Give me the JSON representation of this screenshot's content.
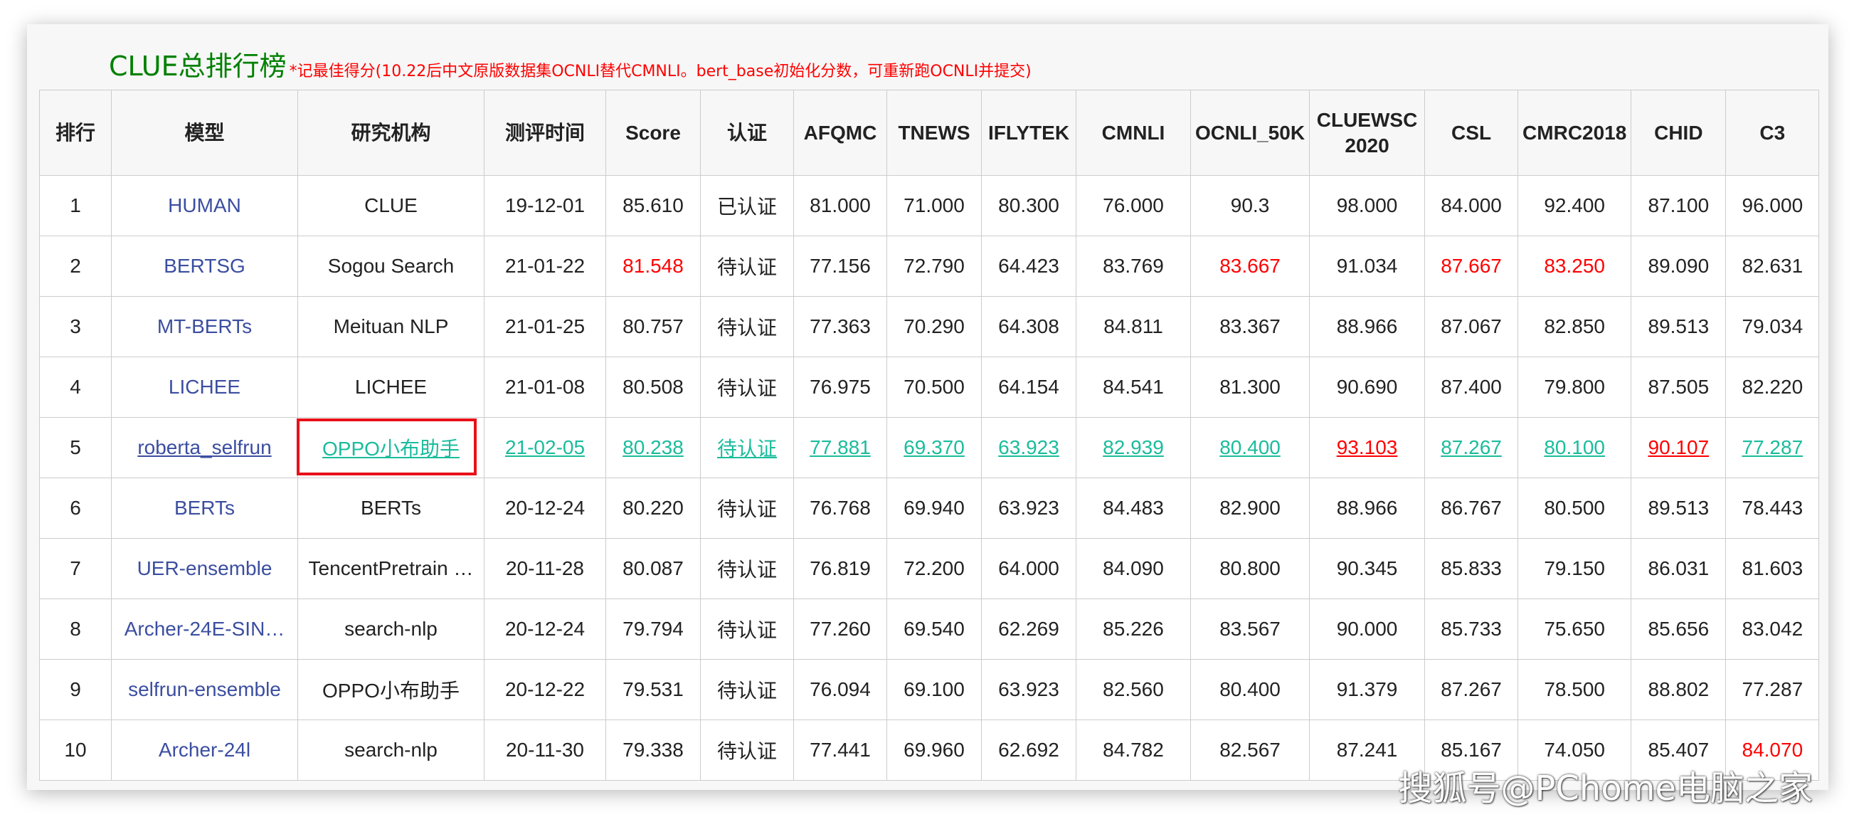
{
  "header": {
    "title": "CLUE总排行榜",
    "subtitle": "*记最佳得分(10.22后中文原版数据集OCNLI替代CMNLI。bert_base初始化分数，可重新跑OCNLI并提交)"
  },
  "columns": [
    "排行",
    "模型",
    "研究机构",
    "测评时间",
    "Score",
    "认证",
    "AFQMC",
    "TNEWS",
    "IFLYTEK",
    "CMNLI",
    "OCNLI_50K",
    "CLUEWSC 2020",
    "CSL",
    "CMRC2018",
    "CHID",
    "C3"
  ],
  "rows": [
    {
      "cells": [
        "1",
        "HUMAN",
        "CLUE",
        "19-12-01",
        "85.610",
        "已认证",
        "81.000",
        "71.000",
        "80.300",
        "76.000",
        "90.3",
        "98.000",
        "84.000",
        "92.400",
        "87.100",
        "96.000"
      ],
      "red": []
    },
    {
      "cells": [
        "2",
        "BERTSG",
        "Sogou Search",
        "21-01-22",
        "81.548",
        "待认证",
        "77.156",
        "72.790",
        "64.423",
        "83.769",
        "83.667",
        "91.034",
        "87.667",
        "83.250",
        "89.090",
        "82.631"
      ],
      "red": [
        4,
        10,
        12,
        13
      ]
    },
    {
      "cells": [
        "3",
        "MT-BERTs",
        "Meituan NLP",
        "21-01-25",
        "80.757",
        "待认证",
        "77.363",
        "70.290",
        "64.308",
        "84.811",
        "83.367",
        "88.966",
        "87.067",
        "82.850",
        "89.513",
        "79.034"
      ],
      "red": []
    },
    {
      "cells": [
        "4",
        "LICHEE",
        "LICHEE",
        "21-01-08",
        "80.508",
        "待认证",
        "76.975",
        "70.500",
        "64.154",
        "84.541",
        "81.300",
        "90.690",
        "87.400",
        "79.800",
        "87.505",
        "82.220"
      ],
      "red": []
    },
    {
      "cells": [
        "5",
        "roberta_selfrun",
        "OPPO小布助手",
        "21-02-05",
        "80.238",
        "待认证",
        "77.881",
        "69.370",
        "63.923",
        "82.939",
        "80.400",
        "93.103",
        "87.267",
        "80.100",
        "90.107",
        "77.287"
      ],
      "red": [
        11,
        14
      ],
      "highlight": true
    },
    {
      "cells": [
        "6",
        "BERTs",
        "BERTs",
        "20-12-24",
        "80.220",
        "待认证",
        "76.768",
        "69.940",
        "63.923",
        "84.483",
        "82.900",
        "88.966",
        "86.767",
        "80.500",
        "89.513",
        "78.443"
      ],
      "red": []
    },
    {
      "cells": [
        "7",
        "UER-ensemble",
        "TencentPretrain …",
        "20-11-28",
        "80.087",
        "待认证",
        "76.819",
        "72.200",
        "64.000",
        "84.090",
        "80.800",
        "90.345",
        "85.833",
        "79.150",
        "86.031",
        "81.603"
      ],
      "red": []
    },
    {
      "cells": [
        "8",
        "Archer-24E-SIN…",
        "search-nlp",
        "20-12-24",
        "79.794",
        "待认证",
        "77.260",
        "69.540",
        "62.269",
        "85.226",
        "83.567",
        "90.000",
        "85.733",
        "75.650",
        "85.656",
        "83.042"
      ],
      "red": []
    },
    {
      "cells": [
        "9",
        "selfrun-ensemble",
        "OPPO小布助手",
        "20-12-22",
        "79.531",
        "待认证",
        "76.094",
        "69.100",
        "63.923",
        "82.560",
        "80.400",
        "91.379",
        "87.267",
        "78.500",
        "88.802",
        "77.287"
      ],
      "red": []
    },
    {
      "cells": [
        "10",
        "Archer-24l",
        "search-nlp",
        "20-11-30",
        "79.338",
        "待认证",
        "77.441",
        "69.960",
        "62.692",
        "84.782",
        "82.567",
        "87.241",
        "85.167",
        "74.050",
        "85.407",
        "84.070"
      ],
      "red": [
        15
      ]
    }
  ],
  "watermark": "搜狐号@PChome电脑之家",
  "colors": {
    "title": "#008000",
    "subtitle": "#ff0000",
    "model_link": "#3b4ea0",
    "highlight": "#1abc9c",
    "best": "#ff0000",
    "box": "#e8101a"
  }
}
